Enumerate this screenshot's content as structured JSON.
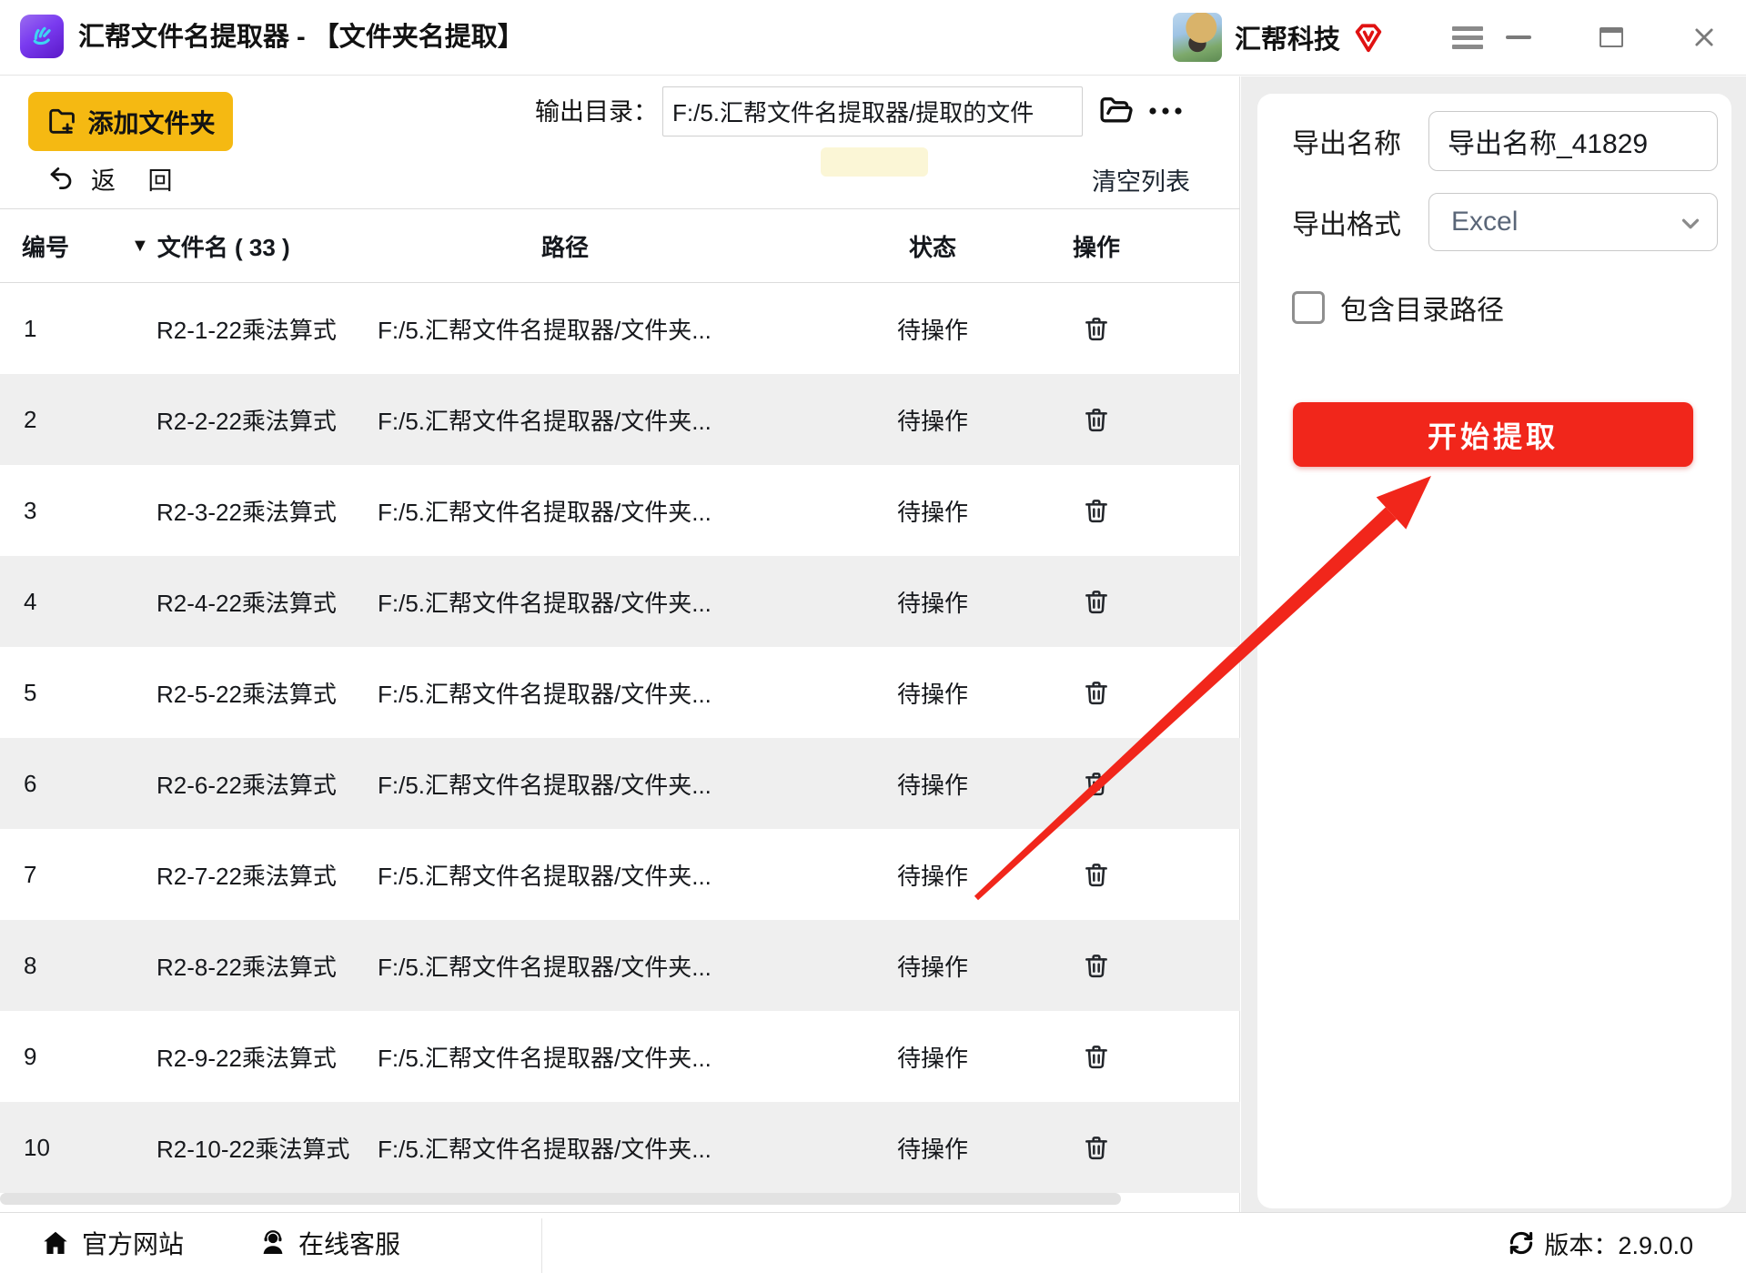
{
  "titlebar": {
    "app_title": "汇帮文件名提取器 - 【文件夹名提取】",
    "brand_name": "汇帮科技"
  },
  "toolbar": {
    "add_folder_button": "添加文件夹",
    "output_dir_label": "输出目录：",
    "output_dir_value": "F:/5.汇帮文件名提取器/提取的文件",
    "back_button": "返 回",
    "clear_list_button": "清空列表"
  },
  "table": {
    "headers": {
      "index": "编号",
      "filename": "文件名 ( 33 )",
      "path": "路径",
      "status": "状态",
      "action": "操作"
    },
    "rows": [
      {
        "index": "1",
        "name": "R2-1-22乘法算式",
        "path": "F:/5.汇帮文件名提取器/文件夹...",
        "status": "待操作"
      },
      {
        "index": "2",
        "name": "R2-2-22乘法算式",
        "path": "F:/5.汇帮文件名提取器/文件夹...",
        "status": "待操作"
      },
      {
        "index": "3",
        "name": "R2-3-22乘法算式",
        "path": "F:/5.汇帮文件名提取器/文件夹...",
        "status": "待操作"
      },
      {
        "index": "4",
        "name": "R2-4-22乘法算式",
        "path": "F:/5.汇帮文件名提取器/文件夹...",
        "status": "待操作"
      },
      {
        "index": "5",
        "name": "R2-5-22乘法算式",
        "path": "F:/5.汇帮文件名提取器/文件夹...",
        "status": "待操作"
      },
      {
        "index": "6",
        "name": "R2-6-22乘法算式",
        "path": "F:/5.汇帮文件名提取器/文件夹...",
        "status": "待操作"
      },
      {
        "index": "7",
        "name": "R2-7-22乘法算式",
        "path": "F:/5.汇帮文件名提取器/文件夹...",
        "status": "待操作"
      },
      {
        "index": "8",
        "name": "R2-8-22乘法算式",
        "path": "F:/5.汇帮文件名提取器/文件夹...",
        "status": "待操作"
      },
      {
        "index": "9",
        "name": "R2-9-22乘法算式",
        "path": "F:/5.汇帮文件名提取器/文件夹...",
        "status": "待操作"
      },
      {
        "index": "10",
        "name": "R2-10-22乘法算式",
        "path": "F:/5.汇帮文件名提取器/文件夹...",
        "status": "待操作"
      }
    ]
  },
  "side_panel": {
    "export_name_label": "导出名称",
    "export_name_value": "导出名称_41829",
    "export_format_label": "导出格式",
    "export_format_value": "Excel",
    "include_path_label": "包含目录路径",
    "include_path_checked": false,
    "start_button": "开始提取"
  },
  "footer": {
    "website_link": "官方网站",
    "support_link": "在线客服",
    "version_text": "版本：2.9.0.0"
  },
  "colors": {
    "accent_yellow": "#F5B912",
    "accent_red": "#F1261B",
    "row_alt_gray": "#EFEFEF",
    "excel_text_gray": "#5A6678",
    "vip_badge_red": "#E01212"
  }
}
